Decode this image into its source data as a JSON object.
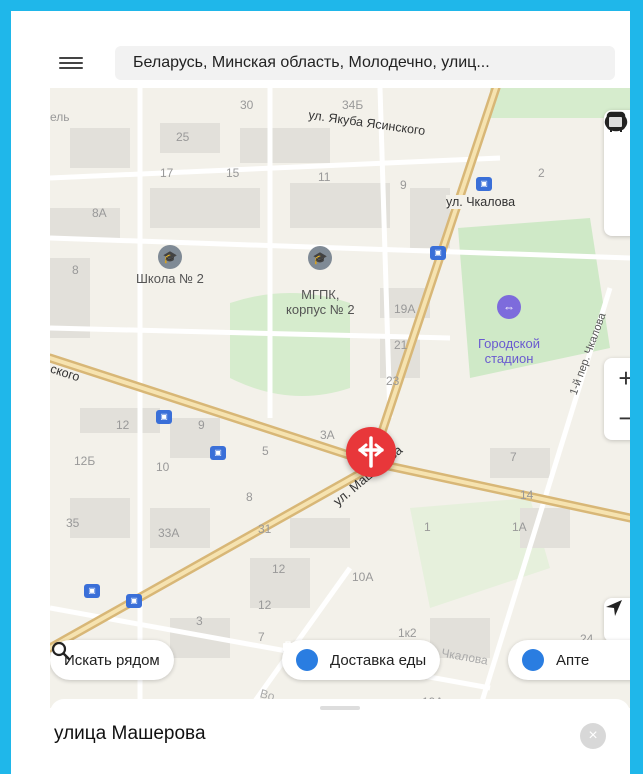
{
  "header": {
    "address": "Беларусь, Минская область, Молодечно, улиц..."
  },
  "map": {
    "streets": [
      "ул. Якуба Ясинского",
      "ул. Чкалова",
      "ул. Машерова",
      "ского",
      "1-й пер. Чкалова",
      "ул. Чкалова",
      "Во"
    ],
    "poi": [
      {
        "label": "Школа № 2"
      },
      {
        "label": "МГПК,\nкорпус № 2"
      },
      {
        "label": "Городской\nстадион"
      }
    ],
    "house_numbers": [
      "30",
      "34Б",
      "25",
      "17",
      "15",
      "11",
      "9",
      "2",
      "8А",
      "8",
      "19А",
      "21",
      "23",
      "3А",
      "12",
      "9",
      "5",
      "12Б",
      "10",
      "8",
      "7",
      "14",
      "35",
      "33А",
      "31",
      "1",
      "1А",
      "12",
      "10А",
      "12",
      "3",
      "7",
      "11",
      "1к2",
      "24",
      "19А",
      "ель"
    ]
  },
  "controls": {
    "zoom_in": "+",
    "zoom_out": "−"
  },
  "chips": [
    {
      "label": "Искать рядом",
      "icon": "search-icon"
    },
    {
      "label": "Доставка еды",
      "icon": "shopping-bag-icon"
    },
    {
      "label": "Апте",
      "icon": "pill-icon"
    }
  ],
  "sheet": {
    "title": "улица Машерова",
    "close": "×"
  },
  "colors": {
    "frame": "#1fb7ea",
    "pin": "#e8373a",
    "major_road": "#d8b777",
    "stadium": "#7d6bdc",
    "accent": "#2a7de1"
  }
}
